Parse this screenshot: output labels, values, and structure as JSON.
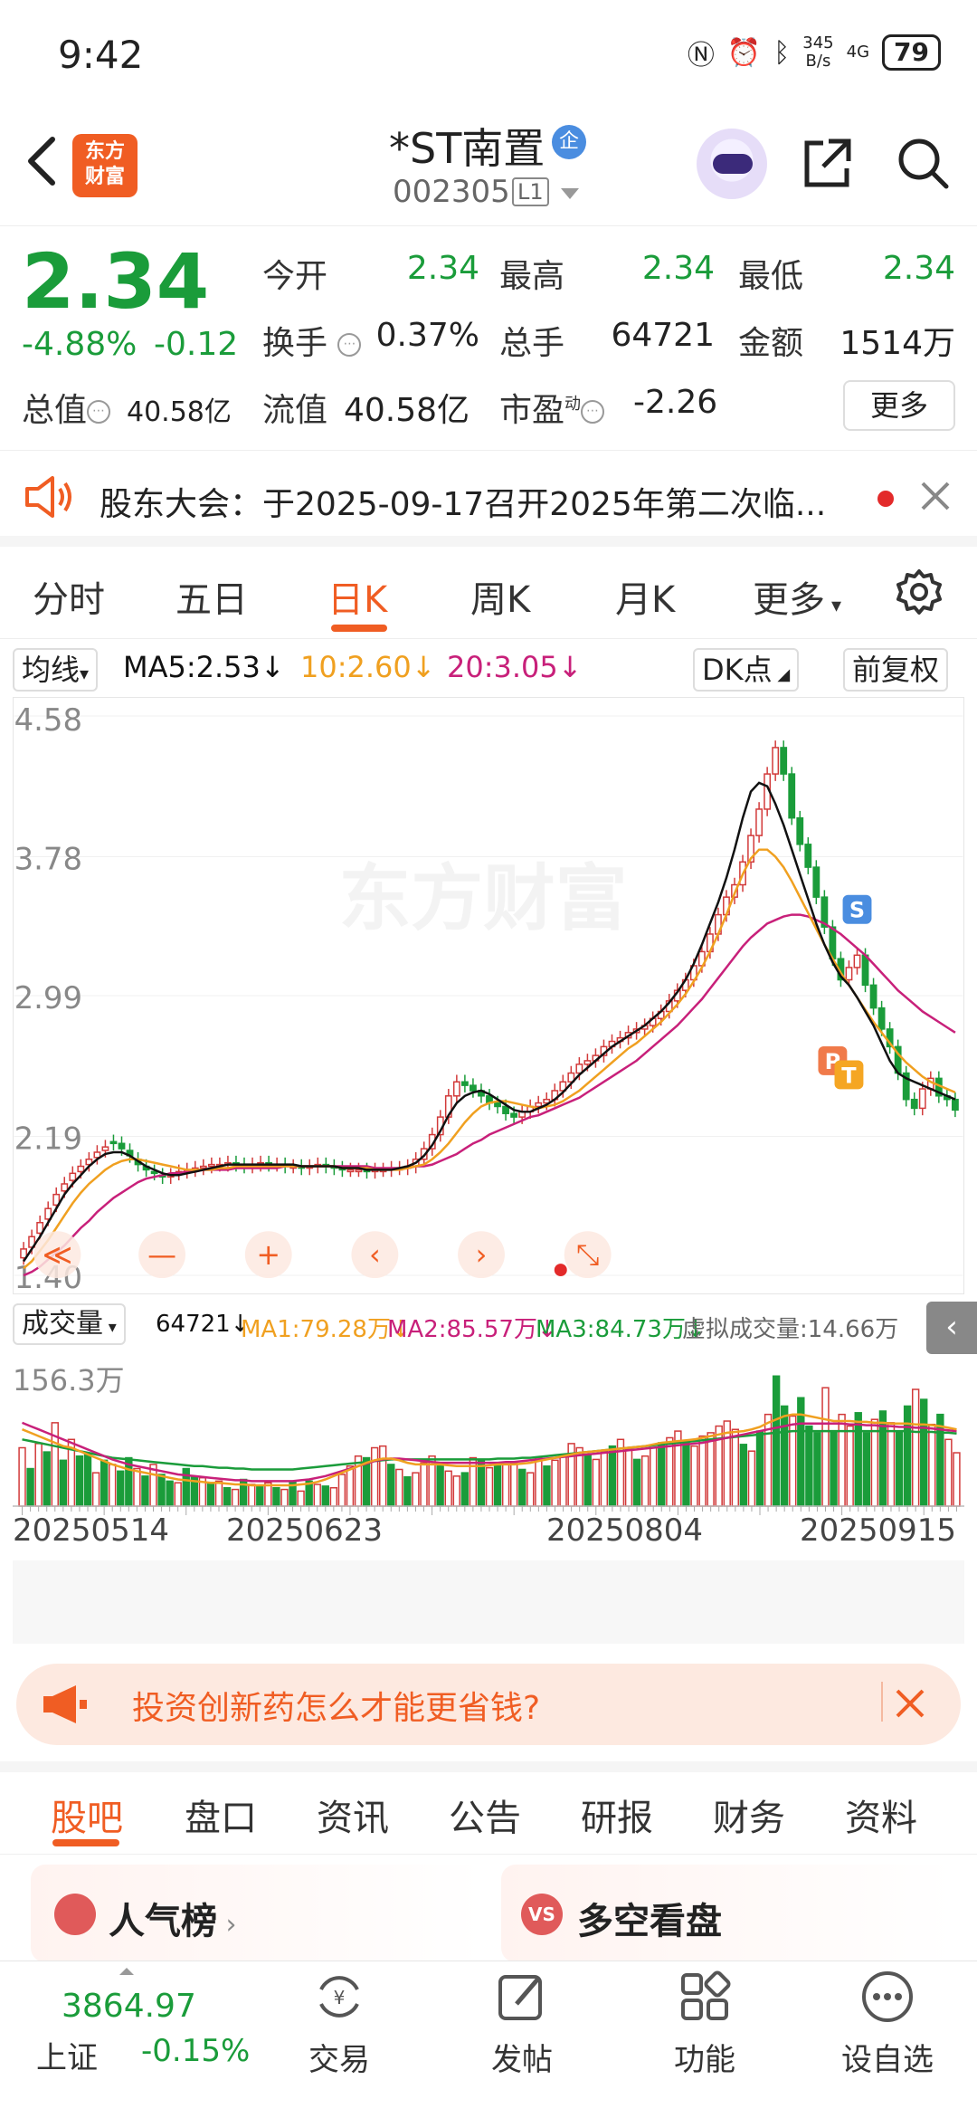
{
  "status_bar": {
    "time": "9:42",
    "net_speed_top": "345",
    "net_speed_bottom": "B/s",
    "network": "4G",
    "battery": "79"
  },
  "header": {
    "logo_line1": "东方",
    "logo_line2": "财富",
    "stock_name": "*ST南置",
    "badge": "企",
    "code": "002305",
    "level": "L1"
  },
  "quote": {
    "price": "2.34",
    "change_pct": "-4.88%",
    "change": "-0.12",
    "open_label": "今开",
    "open": "2.34",
    "high_label": "最高",
    "high": "2.34",
    "low_label": "最低",
    "low": "2.34",
    "turnover_label": "换手",
    "turnover": "0.37%",
    "volume_label": "总手",
    "volume": "64721",
    "amount_label": "金额",
    "amount": "1514万",
    "mktcap_label": "总值",
    "mktcap": "40.58亿",
    "float_label": "流值",
    "float": "40.58亿",
    "pe_label": "市盈",
    "pe_sup": "动",
    "pe": "-2.26",
    "more": "更多"
  },
  "notice": {
    "text": "股东大会：于2025-09-17召开2025年第二次临..."
  },
  "period_tabs": [
    "分时",
    "五日",
    "日K",
    "周K",
    "月K",
    "更多"
  ],
  "active_period": "日K",
  "ma_bar": {
    "selector": "均线",
    "ma5": "MA5:2.53",
    "ma10": "10:2.60",
    "ma20": "20:3.05",
    "dk": "DK点",
    "adjust": "前复权"
  },
  "colors": {
    "up": "#d23a3a",
    "down": "#1a9c3a",
    "ma5": "#111111",
    "ma10": "#f0a020",
    "ma20": "#c8207a",
    "accent": "#f05d23"
  },
  "chart_data": [
    {
      "type": "candlestick",
      "y_ticks": [
        "4.58",
        "3.78",
        "2.99",
        "2.19",
        "1.40"
      ],
      "ylim": [
        1.4,
        4.58
      ],
      "x_ticks": [
        "20250514",
        "20250623",
        "20250804",
        "20250915"
      ],
      "close": [
        1.55,
        1.62,
        1.7,
        1.78,
        1.86,
        1.92,
        1.98,
        2.02,
        2.06,
        2.1,
        2.13,
        2.15,
        2.12,
        2.08,
        2.03,
        2.0,
        1.98,
        1.96,
        1.97,
        1.99,
        2.0,
        2.01,
        2.02,
        2.03,
        2.03,
        2.04,
        2.03,
        2.02,
        2.03,
        2.04,
        2.03,
        2.03,
        2.02,
        2.02,
        2.01,
        2.02,
        2.03,
        2.02,
        2.01,
        2.0,
        2.0,
        2.0,
        1.99,
        2.0,
        2.0,
        2.01,
        2.01,
        2.02,
        2.06,
        2.12,
        2.2,
        2.3,
        2.42,
        2.5,
        2.48,
        2.45,
        2.42,
        2.38,
        2.36,
        2.32,
        2.3,
        2.33,
        2.36,
        2.38,
        2.4,
        2.45,
        2.5,
        2.55,
        2.6,
        2.62,
        2.65,
        2.7,
        2.73,
        2.75,
        2.78,
        2.8,
        2.82,
        2.86,
        2.9,
        2.96,
        3.02,
        3.08,
        3.16,
        3.24,
        3.34,
        3.45,
        3.55,
        3.62,
        3.75,
        3.9,
        4.05,
        4.25,
        4.4,
        4.25,
        4.0,
        3.85,
        3.72,
        3.55,
        3.38,
        3.2,
        3.08,
        3.15,
        3.22,
        3.05,
        2.92,
        2.8,
        2.7,
        2.55,
        2.4,
        2.35,
        2.46,
        2.52,
        2.42,
        2.4,
        2.34
      ],
      "open": [
        1.5,
        1.56,
        1.64,
        1.72,
        1.8,
        1.88,
        1.94,
        1.99,
        2.03,
        2.07,
        2.11,
        2.16,
        2.15,
        2.11,
        2.06,
        2.02,
        1.99,
        1.97,
        1.96,
        1.98,
        1.99,
        2.0,
        2.01,
        2.02,
        2.03,
        2.03,
        2.04,
        2.03,
        2.02,
        2.03,
        2.04,
        2.03,
        2.03,
        2.02,
        2.02,
        2.01,
        2.02,
        2.03,
        2.02,
        2.01,
        2.0,
        2.0,
        2.0,
        1.99,
        2.0,
        2.0,
        2.01,
        2.01,
        2.02,
        2.06,
        2.12,
        2.2,
        2.3,
        2.42,
        2.5,
        2.48,
        2.45,
        2.42,
        2.38,
        2.36,
        2.32,
        2.3,
        2.33,
        2.36,
        2.38,
        2.4,
        2.45,
        2.5,
        2.55,
        2.6,
        2.62,
        2.65,
        2.7,
        2.73,
        2.75,
        2.78,
        2.8,
        2.82,
        2.86,
        2.9,
        2.96,
        3.02,
        3.08,
        3.16,
        3.24,
        3.34,
        3.45,
        3.55,
        3.62,
        3.75,
        3.9,
        4.05,
        4.25,
        4.4,
        4.25,
        4.0,
        3.85,
        3.72,
        3.55,
        3.38,
        3.2,
        3.08,
        3.15,
        3.22,
        3.05,
        2.92,
        2.8,
        2.7,
        2.55,
        2.4,
        2.35,
        2.46,
        2.52,
        2.42,
        2.4
      ],
      "ma5": [
        1.48,
        1.55,
        1.62,
        1.7,
        1.78,
        1.86,
        1.92,
        1.97,
        2.02,
        2.06,
        2.09,
        2.1,
        2.1,
        2.08,
        2.05,
        2.02,
        2.0,
        1.98,
        1.97,
        1.97,
        1.98,
        1.99,
        2.0,
        2.01,
        2.02,
        2.03,
        2.03,
        2.03,
        2.03,
        2.03,
        2.03,
        2.03,
        2.03,
        2.03,
        2.02,
        2.02,
        2.02,
        2.02,
        2.02,
        2.01,
        2.01,
        2.01,
        2.0,
        2.0,
        2.0,
        2.0,
        2.01,
        2.02,
        2.04,
        2.08,
        2.14,
        2.22,
        2.31,
        2.38,
        2.42,
        2.44,
        2.45,
        2.43,
        2.4,
        2.37,
        2.34,
        2.33,
        2.33,
        2.35,
        2.37,
        2.4,
        2.44,
        2.49,
        2.54,
        2.58,
        2.62,
        2.66,
        2.7,
        2.73,
        2.76,
        2.79,
        2.82,
        2.86,
        2.9,
        2.95,
        3.01,
        3.08,
        3.17,
        3.28,
        3.4,
        3.52,
        3.66,
        3.82,
        4.0,
        4.15,
        4.2,
        4.18,
        4.08,
        3.96,
        3.82,
        3.68,
        3.54,
        3.4,
        3.28,
        3.18,
        3.1,
        3.05,
        2.98,
        2.9,
        2.82,
        2.72,
        2.62,
        2.55,
        2.52,
        2.5,
        2.48,
        2.46,
        2.44,
        2.42,
        2.4
      ],
      "ma10": [
        1.44,
        1.48,
        1.54,
        1.6,
        1.67,
        1.74,
        1.81,
        1.87,
        1.92,
        1.96,
        2.0,
        2.03,
        2.05,
        2.06,
        2.06,
        2.05,
        2.04,
        2.03,
        2.02,
        2.01,
        2.0,
        2.0,
        2.0,
        2.0,
        2.01,
        2.01,
        2.02,
        2.02,
        2.02,
        2.02,
        2.02,
        2.02,
        2.02,
        2.02,
        2.02,
        2.02,
        2.02,
        2.02,
        2.02,
        2.01,
        2.01,
        2.01,
        2.01,
        2.0,
        2.0,
        2.0,
        2.0,
        2.01,
        2.02,
        2.03,
        2.06,
        2.1,
        2.15,
        2.21,
        2.27,
        2.32,
        2.36,
        2.38,
        2.39,
        2.39,
        2.38,
        2.37,
        2.36,
        2.35,
        2.36,
        2.37,
        2.39,
        2.42,
        2.45,
        2.49,
        2.53,
        2.57,
        2.61,
        2.65,
        2.69,
        2.72,
        2.76,
        2.8,
        2.84,
        2.89,
        2.94,
        3.0,
        3.07,
        3.15,
        3.24,
        3.34,
        3.45,
        3.57,
        3.68,
        3.77,
        3.82,
        3.82,
        3.78,
        3.72,
        3.64,
        3.55,
        3.46,
        3.37,
        3.28,
        3.2,
        3.12,
        3.05,
        2.98,
        2.91,
        2.84,
        2.78,
        2.72,
        2.66,
        2.61,
        2.57,
        2.53,
        2.5,
        2.48,
        2.46,
        2.44
      ],
      "ma20": [
        1.4,
        1.42,
        1.45,
        1.49,
        1.53,
        1.57,
        1.62,
        1.67,
        1.71,
        1.76,
        1.8,
        1.84,
        1.87,
        1.9,
        1.93,
        1.95,
        1.96,
        1.97,
        1.98,
        1.98,
        1.99,
        1.99,
        2.0,
        2.0,
        2.0,
        2.0,
        2.01,
        2.01,
        2.01,
        2.01,
        2.01,
        2.01,
        2.02,
        2.02,
        2.02,
        2.02,
        2.02,
        2.02,
        2.02,
        2.02,
        2.02,
        2.02,
        2.02,
        2.01,
        2.01,
        2.01,
        2.01,
        2.01,
        2.02,
        2.02,
        2.03,
        2.05,
        2.07,
        2.09,
        2.12,
        2.15,
        2.17,
        2.2,
        2.22,
        2.24,
        2.26,
        2.28,
        2.3,
        2.31,
        2.33,
        2.35,
        2.37,
        2.39,
        2.41,
        2.44,
        2.47,
        2.5,
        2.53,
        2.56,
        2.59,
        2.62,
        2.66,
        2.7,
        2.74,
        2.78,
        2.82,
        2.87,
        2.92,
        2.97,
        3.03,
        3.09,
        3.15,
        3.21,
        3.27,
        3.32,
        3.36,
        3.4,
        3.42,
        3.44,
        3.45,
        3.45,
        3.44,
        3.42,
        3.4,
        3.37,
        3.34,
        3.3,
        3.26,
        3.22,
        3.17,
        3.12,
        3.07,
        3.02,
        2.98,
        2.94,
        2.9,
        2.87,
        2.84,
        2.81,
        2.78
      ],
      "annotations": [
        "S",
        "P",
        "T"
      ]
    },
    {
      "type": "bar",
      "title": "成交量",
      "y_ticks": [
        "156.3万"
      ],
      "ylim": [
        0,
        156.3
      ],
      "volume": [
        70,
        45,
        75,
        65,
        100,
        55,
        80,
        60,
        62,
        40,
        55,
        50,
        42,
        58,
        45,
        36,
        50,
        38,
        30,
        28,
        45,
        36,
        34,
        28,
        30,
        22,
        20,
        32,
        26,
        24,
        28,
        22,
        20,
        30,
        18,
        30,
        26,
        24,
        22,
        38,
        48,
        60,
        58,
        70,
        72,
        50,
        44,
        35,
        40,
        52,
        60,
        48,
        42,
        36,
        40,
        58,
        55,
        46,
        48,
        50,
        52,
        44,
        40,
        58,
        48,
        55,
        62,
        75,
        70,
        62,
        56,
        66,
        72,
        80,
        68,
        56,
        60,
        70,
        76,
        82,
        90,
        78,
        72,
        84,
        88,
        96,
        102,
        92,
        74,
        66,
        90,
        110,
        156,
        120,
        108,
        130,
        96,
        88,
        142,
        90,
        110,
        96,
        112,
        88,
        104,
        114,
        100,
        90,
        120,
        140,
        128,
        98,
        110,
        80,
        64
      ],
      "volume_up": [
        true,
        false,
        true,
        false,
        true,
        false,
        true,
        false,
        false,
        true,
        false,
        true,
        false,
        false,
        true,
        false,
        true,
        false,
        false,
        true,
        false,
        false,
        true,
        false,
        true,
        false,
        true,
        false,
        true,
        false,
        true,
        false,
        true,
        false,
        true,
        false,
        true,
        false,
        true,
        true,
        true,
        true,
        false,
        true,
        true,
        false,
        true,
        false,
        true,
        true,
        true,
        false,
        true,
        true,
        false,
        true,
        false,
        true,
        false,
        true,
        true,
        false,
        true,
        true,
        false,
        true,
        true,
        true,
        true,
        false,
        true,
        true,
        false,
        true,
        true,
        false,
        true,
        true,
        false,
        true,
        true,
        false,
        true,
        true,
        true,
        true,
        true,
        true,
        false,
        true,
        false,
        true,
        false,
        false,
        true,
        false,
        false,
        false,
        true,
        false,
        true,
        true,
        false,
        false,
        true,
        false,
        true,
        false,
        false,
        true,
        false,
        true,
        false,
        true,
        true
      ],
      "ma1": [
        92,
        88,
        84,
        80,
        76,
        72,
        70,
        66,
        62,
        58,
        54,
        50,
        47,
        44,
        42,
        40,
        38,
        36,
        34,
        32,
        31,
        30,
        29,
        28,
        28,
        27,
        26,
        26,
        25,
        25,
        25,
        25,
        25,
        25,
        26,
        27,
        29,
        32,
        36,
        40,
        44,
        48,
        52,
        55,
        57,
        57,
        55,
        52,
        50,
        50,
        50,
        50,
        49,
        48,
        48,
        48,
        48,
        49,
        50,
        50,
        50,
        51,
        52,
        54,
        56,
        58,
        60,
        62,
        64,
        65,
        66,
        67,
        68,
        69,
        70,
        71,
        72,
        74,
        76,
        77,
        78,
        79,
        80,
        82,
        84,
        86,
        88,
        89,
        90,
        92,
        95,
        100,
        104,
        108,
        110,
        110,
        108,
        106,
        104,
        102,
        102,
        102,
        101,
        101,
        100,
        100,
        99,
        99,
        99,
        98,
        98,
        97,
        96,
        94,
        92
      ],
      "ma2": [
        100,
        96,
        92,
        88,
        84,
        80,
        76,
        72,
        68,
        64,
        60,
        56,
        53,
        50,
        48,
        46,
        44,
        42,
        40,
        38,
        37,
        36,
        35,
        34,
        33,
        32,
        31,
        31,
        30,
        30,
        30,
        30,
        30,
        30,
        31,
        32,
        34,
        36,
        39,
        42,
        45,
        48,
        51,
        54,
        56,
        57,
        57,
        56,
        55,
        54,
        53,
        52,
        52,
        52,
        52,
        52,
        52,
        52,
        52,
        53,
        53,
        54,
        55,
        56,
        57,
        58,
        59,
        60,
        61,
        62,
        63,
        64,
        65,
        66,
        67,
        68,
        69,
        70,
        71,
        72,
        73,
        74,
        75,
        76,
        78,
        80,
        82,
        84,
        86,
        88,
        90,
        92,
        94,
        96,
        98,
        99,
        99,
        99,
        99,
        99,
        99,
        98,
        98,
        97,
        97,
        96,
        96,
        95,
        95,
        94,
        94,
        93,
        92,
        91,
        90
      ],
      "ma3": [
        80,
        78,
        76,
        74,
        72,
        70,
        68,
        66,
        64,
        62,
        60,
        58,
        57,
        56,
        55,
        54,
        53,
        52,
        51,
        50,
        49,
        48,
        48,
        47,
        46,
        46,
        45,
        45,
        44,
        44,
        44,
        44,
        44,
        44,
        45,
        46,
        47,
        48,
        49,
        50,
        51,
        52,
        53,
        54,
        55,
        56,
        56,
        56,
        56,
        56,
        56,
        56,
        56,
        56,
        56,
        56,
        56,
        56,
        57,
        57,
        57,
        58,
        58,
        59,
        60,
        61,
        62,
        63,
        64,
        65,
        66,
        67,
        68,
        69,
        70,
        71,
        72,
        73,
        74,
        75,
        76,
        77,
        78,
        79,
        80,
        81,
        82,
        83,
        84,
        85,
        86,
        87,
        88,
        89,
        90,
        90,
        90,
        90,
        90,
        90,
        90,
        90,
        90,
        90,
        90,
        90,
        90,
        90,
        90,
        89,
        89,
        89,
        88,
        88,
        87
      ]
    }
  ],
  "volume_bar": {
    "selector": "成交量",
    "vol": "64721",
    "ma1": "MA1:79.28万",
    "ma2": "MA2:85.57万",
    "ma3": "MA3:84.73万",
    "virtual": "虚拟成交量:14.66万"
  },
  "banner": {
    "text": "投资创新药怎么才能更省钱?"
  },
  "content_tabs": [
    "股吧",
    "盘口",
    "资讯",
    "公告",
    "研报",
    "财务",
    "资料"
  ],
  "active_content_tab": "股吧",
  "cards": {
    "popular": "人气榜",
    "longshort": "多空看盘"
  },
  "index": {
    "value": "3864.97",
    "name": "上证",
    "change": "-0.15%"
  },
  "nav": [
    "交易",
    "发帖",
    "功能",
    "设自选"
  ]
}
